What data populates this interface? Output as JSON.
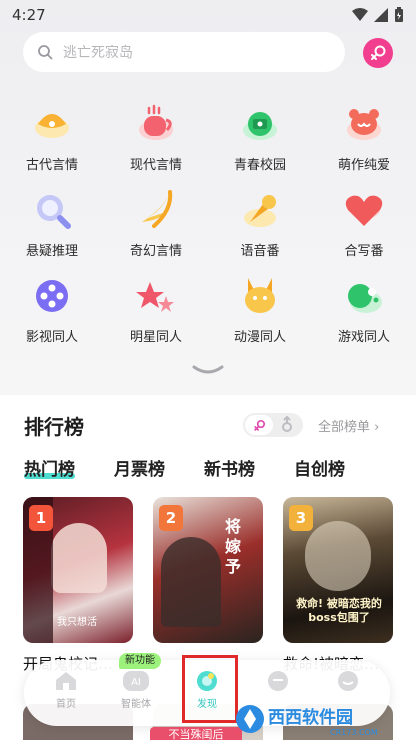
{
  "status_bar": {
    "time": "4:27"
  },
  "search": {
    "placeholder": "逃亡死寂岛"
  },
  "categories": [
    {
      "label": "古代言情",
      "icon": "fan-icon"
    },
    {
      "label": "现代言情",
      "icon": "coffee-cup-icon"
    },
    {
      "label": "青春校园",
      "icon": "school-bell-icon"
    },
    {
      "label": "萌作纯爱",
      "icon": "bear-icon"
    },
    {
      "label": "悬疑推理",
      "icon": "magnifier-icon"
    },
    {
      "label": "奇幻言情",
      "icon": "wing-icon"
    },
    {
      "label": "语音番",
      "icon": "microphone-icon"
    },
    {
      "label": "合写番",
      "icon": "heart-icon"
    },
    {
      "label": "影视同人",
      "icon": "film-reel-icon"
    },
    {
      "label": "明星同人",
      "icon": "stars-icon"
    },
    {
      "label": "动漫同人",
      "icon": "pikachu-icon"
    },
    {
      "label": "游戏同人",
      "icon": "gamepad-icon"
    }
  ],
  "ranking": {
    "title": "排行榜",
    "all_lists": "全部榜单 ›",
    "tabs": [
      "热门榜",
      "月票榜",
      "新书榜",
      "自创榜"
    ],
    "books": [
      {
        "rank": "1",
        "title": "开局鬼校记…",
        "badge_color": "#f2553a",
        "cover_text": "我只想活"
      },
      {
        "rank": "2",
        "title": "…",
        "badge_color": "#f2763a",
        "cover_text": "将嫁予"
      },
      {
        "rank": "3",
        "title": "救命!被暗恋…",
        "badge_color": "#f2b13a",
        "cover_text": "救命! 被暗恋我的boss包围了"
      }
    ]
  },
  "bottom_nav": {
    "new_badge": "新功能",
    "items": [
      {
        "label": "首页"
      },
      {
        "label": "智能体"
      },
      {
        "label": "发现"
      },
      {
        "label": ""
      },
      {
        "label": ""
      }
    ],
    "bottom_pill": "不当殊闺后"
  },
  "watermark": {
    "text": "西西软件园",
    "sub": "CR173.COM"
  },
  "colors": {
    "accent": "#34c7bd",
    "pink": "#f23e8e"
  }
}
